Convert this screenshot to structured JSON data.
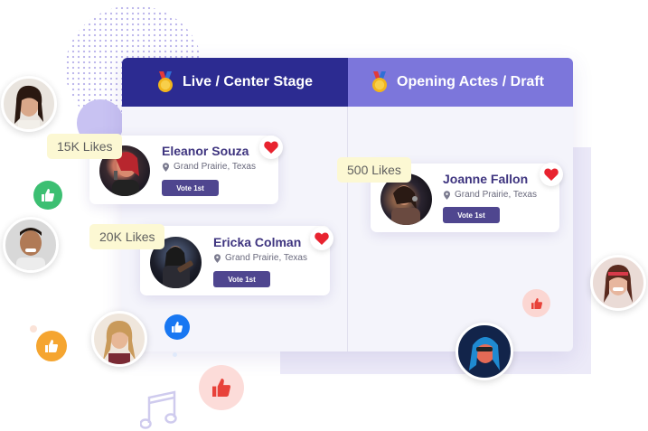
{
  "board": {
    "columns": [
      {
        "title": "Live / Center Stage"
      },
      {
        "title": "Opening Actes / Draft"
      }
    ]
  },
  "performers": [
    {
      "name": "Eleanor Souza",
      "location": "Grand Prairie, Texas",
      "vote_label": "Vote 1st",
      "likes": "15K Likes"
    },
    {
      "name": "Ericka Colman",
      "location": "Grand Prairie, Texas",
      "vote_label": "Vote 1st",
      "likes": "20K Likes"
    },
    {
      "name": "Joanne Fallon",
      "location": "Grand Prairie, Texas",
      "vote_label": "Vote 1st",
      "likes": "500 Likes"
    }
  ],
  "colors": {
    "left_header": "#2c2b91",
    "right_header": "#7c76db",
    "vote_button": "#4f468f",
    "heart": "#e8232f",
    "likes_badge": "#fcf8d3"
  },
  "icons": [
    "medal-icon",
    "heart-icon",
    "location-pin-icon",
    "thumbs-up-icon",
    "music-note-icon"
  ]
}
